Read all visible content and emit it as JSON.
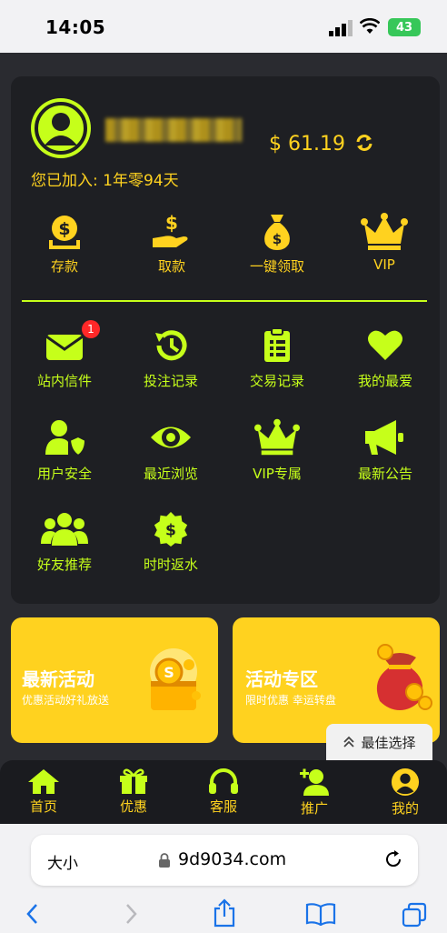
{
  "status_bar": {
    "time": "14:05",
    "battery": "43"
  },
  "profile": {
    "balance": "$ 61.19",
    "joined": "您已加入: 1年零94天"
  },
  "quick_actions": [
    {
      "label": "存款",
      "icon": "deposit-icon"
    },
    {
      "label": "取款",
      "icon": "withdraw-icon"
    },
    {
      "label": "一键领取",
      "icon": "money-bag-icon"
    },
    {
      "label": "VIP",
      "icon": "crown-icon"
    }
  ],
  "grid_items": [
    {
      "label": "站内信件",
      "icon": "mail-icon",
      "badge": "1"
    },
    {
      "label": "投注记录",
      "icon": "history-icon"
    },
    {
      "label": "交易记录",
      "icon": "clipboard-icon"
    },
    {
      "label": "我的最爱",
      "icon": "heart-icon"
    },
    {
      "label": "用户安全",
      "icon": "user-shield-icon"
    },
    {
      "label": "最近浏览",
      "icon": "eye-icon"
    },
    {
      "label": "VIP专属",
      "icon": "crown-icon"
    },
    {
      "label": "最新公告",
      "icon": "megaphone-icon"
    },
    {
      "label": "好友推荐",
      "icon": "users-icon"
    },
    {
      "label": "时时返水",
      "icon": "rebate-badge-icon"
    }
  ],
  "promos": [
    {
      "title": "最新活动",
      "subtitle": "优惠活动好礼放送"
    },
    {
      "title": "活动专区",
      "subtitle": "限时优惠 幸运转盘"
    }
  ],
  "best_pick": "最佳选择",
  "bottom_nav": [
    {
      "label": "首页",
      "icon": "home-icon"
    },
    {
      "label": "优惠",
      "icon": "gift-icon"
    },
    {
      "label": "客服",
      "icon": "headset-icon"
    },
    {
      "label": "推广",
      "icon": "user-plus-icon"
    },
    {
      "label": "我的",
      "icon": "user-circle-icon"
    }
  ],
  "browser": {
    "text_size": "大小",
    "url": "9d9034.com"
  },
  "colors": {
    "accent_yellow": "#ffd21f",
    "accent_lime": "#c6ff1a",
    "card_bg": "#1e1f23",
    "page_bg": "#2a2b30"
  }
}
